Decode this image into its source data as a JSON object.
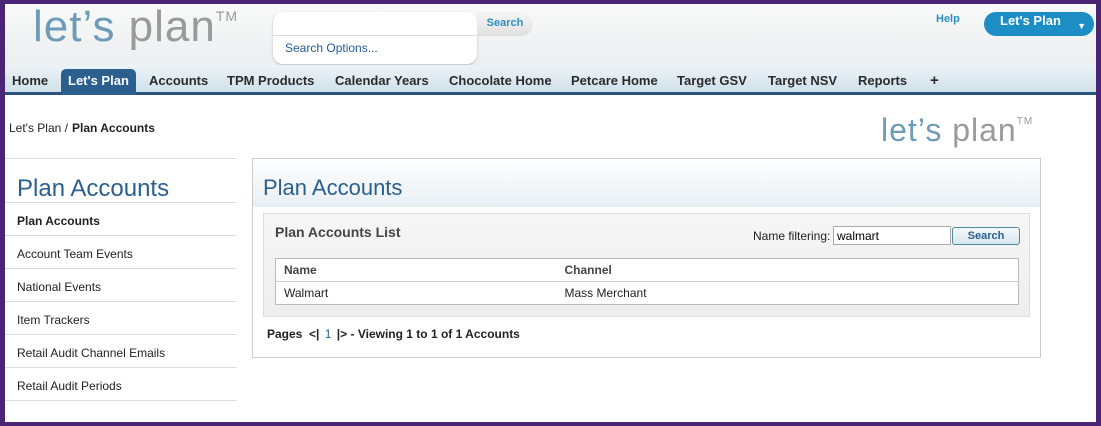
{
  "header": {
    "logo_text": "let’s plan",
    "logo_tm": "TM",
    "search_button": "Search",
    "search_options": "Search Options...",
    "help": "Help",
    "app_button": "Let's Plan"
  },
  "nav": {
    "tabs": [
      "Home",
      "Let's Plan",
      "Accounts",
      "TPM Products",
      "Calendar Years",
      "Chocolate Home",
      "Petcare Home",
      "Target GSV",
      "Target NSV",
      "Reports",
      "+"
    ],
    "active": "Let's Plan"
  },
  "breadcrumb": {
    "parent": "Let's Plan /",
    "current": "Plan Accounts"
  },
  "sidebar": {
    "title": "Plan Accounts",
    "items": [
      "Plan Accounts",
      "Account Team Events",
      "National Events",
      "Item Trackers",
      "Retail Audit Channel Emails",
      "Retail Audit Periods"
    ]
  },
  "main": {
    "title": "Plan Accounts",
    "list_title": "Plan Accounts List",
    "filter_label": "Name filtering:",
    "filter_value": "walmart",
    "filter_button": "Search",
    "columns": [
      "Name",
      "Channel"
    ],
    "rows": [
      [
        "Walmart",
        "Mass Merchant"
      ]
    ],
    "pager": {
      "label": "Pages",
      "prev": "<|",
      "page": "1",
      "next": "|>",
      "summary": "- Viewing 1 to 1 of 1 Accounts"
    }
  }
}
